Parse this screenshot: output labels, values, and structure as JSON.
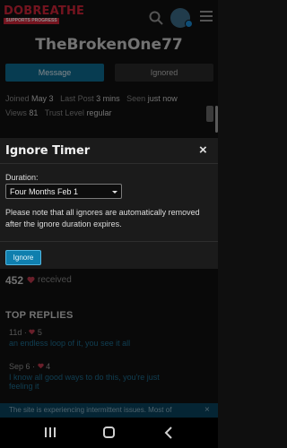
{
  "header": {
    "logo_main": "DOBREATHE",
    "logo_sub": "SUPPORTS PROGRESS"
  },
  "profile": {
    "username": "TheBrokenOne77",
    "message_label": "Message",
    "ignored_label": "Ignored",
    "joined_label": "Joined",
    "joined_value": "May 3",
    "last_post_label": "Last Post",
    "last_post_value": "3 mins",
    "seen_label": "Seen",
    "seen_value": "just now",
    "views_label": "Views",
    "views_value": "81",
    "trust_label": "Trust Level",
    "trust_value": "regular",
    "likes_count": "452",
    "likes_label": "received"
  },
  "top_replies": {
    "title": "TOP REPLIES",
    "items": [
      {
        "meta": "11d ·",
        "count": "5",
        "line1": "an endless loop of it, you see it all",
        "line2": ""
      },
      {
        "meta": "Sep 6 ·",
        "count": "4",
        "line1": "I know all good ways to do this, you're just",
        "line2": "feeling it"
      }
    ]
  },
  "notice": {
    "text": "The site is experiencing intermittent issues. Most of",
    "close": "×"
  },
  "modal": {
    "title": "Ignore Timer",
    "close": "×",
    "duration_label": "Duration:",
    "duration_value": "Four Months Feb 1",
    "note": "Please note that all ignores are automatically removed after the ignore duration expires.",
    "ignore_button": "Ignore"
  },
  "colors": {
    "accent": "#0f7fae",
    "brand_red": "#d4263a",
    "modal_bg": "#1b1b1b"
  },
  "icons": {
    "search": "search-icon",
    "menu": "menu-icon",
    "close": "close-icon",
    "heart": "heart-icon"
  }
}
